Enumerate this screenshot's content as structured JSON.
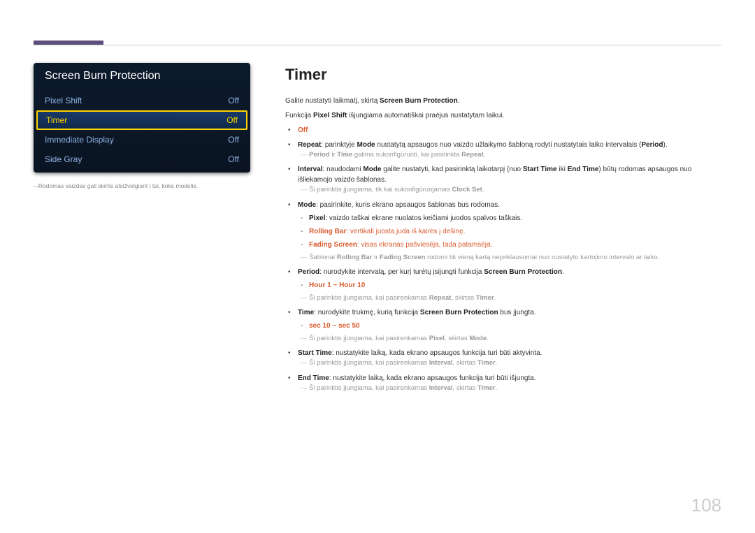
{
  "osd": {
    "title": "Screen Burn Protection",
    "rows": [
      {
        "label": "Pixel Shift",
        "value": "Off",
        "selected": false
      },
      {
        "label": "Timer",
        "value": "Off",
        "selected": true
      },
      {
        "label": "Immediate Display",
        "value": "Off",
        "selected": false
      },
      {
        "label": "Side Gray",
        "value": "Off",
        "selected": false
      }
    ]
  },
  "leftFootnote": "Rodomas vaizdas gali skirtis atsižvelgiant į tai, koks modelis.",
  "heading": "Timer",
  "intro1_a": "Galite nustatyti laikmatį, skirtą ",
  "intro1_b": "Screen Burn Protection",
  "intro1_c": ".",
  "intro2_a": "Funkcija ",
  "intro2_b": "Pixel Shift",
  "intro2_c": " išjungiama automatiškai praėjus nustatytam laikui.",
  "li_off": "Off",
  "li_repeat_a": "Repeat",
  "li_repeat_b": ": parinktyje ",
  "li_repeat_c": "Mode",
  "li_repeat_d": " nustatytą apsaugos nuo vaizdo užlaikymo šabloną rodyti nustatytais laiko intervalais (",
  "li_repeat_e": "Period",
  "li_repeat_f": ").",
  "sub_period_a": "Period",
  "sub_period_b": " ir ",
  "sub_period_c": "Time",
  "sub_period_d": " galima sukonfigūruoti, kai pasirinkta ",
  "sub_period_e": "Repeat",
  "sub_period_f": ".",
  "li_interval_a": "Interval",
  "li_interval_b": ": naudodami ",
  "li_interval_c": "Mode",
  "li_interval_d": " galite nustatyti, kad pasirinktą laikotarpį (nuo ",
  "li_interval_e": "Start Time",
  "li_interval_f": " iki ",
  "li_interval_g": "End Time",
  "li_interval_h": ") būtų rodomas apsaugos nuo išliekamojo vaizdo šablonas.",
  "note_clockset_a": "Ši parinktis įjungiama, tik kai sukonfigūruojamas ",
  "note_clockset_b": "Clock Set",
  "note_clockset_c": ".",
  "li_mode_a": "Mode",
  "li_mode_b": ": pasirinkite, kuris ekrano apsaugos šablonas bus rodomas.",
  "sub_pixel_a": "Pixel",
  "sub_pixel_b": ": vaizdo taškai ekrane nuolatos keičiami juodos spalvos taškais.",
  "sub_rolling_a": "Rolling Bar",
  "sub_rolling_b": ": vertikali juosta juda iš kairės į dešinę.",
  "sub_fading_a": "Fading Screen",
  "sub_fading_b": ": visas ekranas pašviesėja, tada patamsėja.",
  "note_templates_a": "Šablonai ",
  "note_templates_b": "Rolling Bar",
  "note_templates_c": " ir ",
  "note_templates_d": "Fading Screen",
  "note_templates_e": " rodomi tik vieną kartą nepriklausomai nuo nustatyto kartojimo intervalo ar laiko.",
  "li_period2_a": "Period",
  "li_period2_b": ": nurodykite intervalą, per kurį turėtų įsijungti funkcija ",
  "li_period2_c": "Screen Burn Protection",
  "li_period2_d": ".",
  "sub_hour": "Hour 1 ~ Hour 10",
  "note_repeat_timer_a": "Ši parinktis įjungiama, kai pasirenkamas ",
  "note_repeat_timer_b": "Repeat",
  "note_repeat_timer_c": ", skirtas ",
  "note_repeat_timer_d": "Timer",
  "note_repeat_timer_e": ".",
  "li_time_a": "Time",
  "li_time_b": ": nurodykite trukmę, kurią funkcija ",
  "li_time_c": "Screen Burn Protection",
  "li_time_d": " bus įjungta.",
  "sub_sec": "sec 10 ~ sec 50",
  "note_pixel_mode_a": "Ši parinktis įjungiama, kai pasirenkamas ",
  "note_pixel_mode_b": "Pixel",
  "note_pixel_mode_c": ", skirtas ",
  "note_pixel_mode_d": "Mode",
  "note_pixel_mode_e": ".",
  "li_start_a": "Start Time",
  "li_start_b": ": nustatykite laiką, kada ekrano apsaugos funkcija turi būti aktyvinta.",
  "note_interval_timer_a": "Ši parinktis įjungiama, kai pasirenkamas ",
  "note_interval_timer_b": "Interval",
  "note_interval_timer_c": ", skirtas ",
  "note_interval_timer_d": "Timer",
  "note_interval_timer_e": ".",
  "li_end_a": "End Time",
  "li_end_b": ": nustatykite laiką, kada ekrano apsaugos funkcija turi būti išjungta.",
  "pageNumber": "108"
}
